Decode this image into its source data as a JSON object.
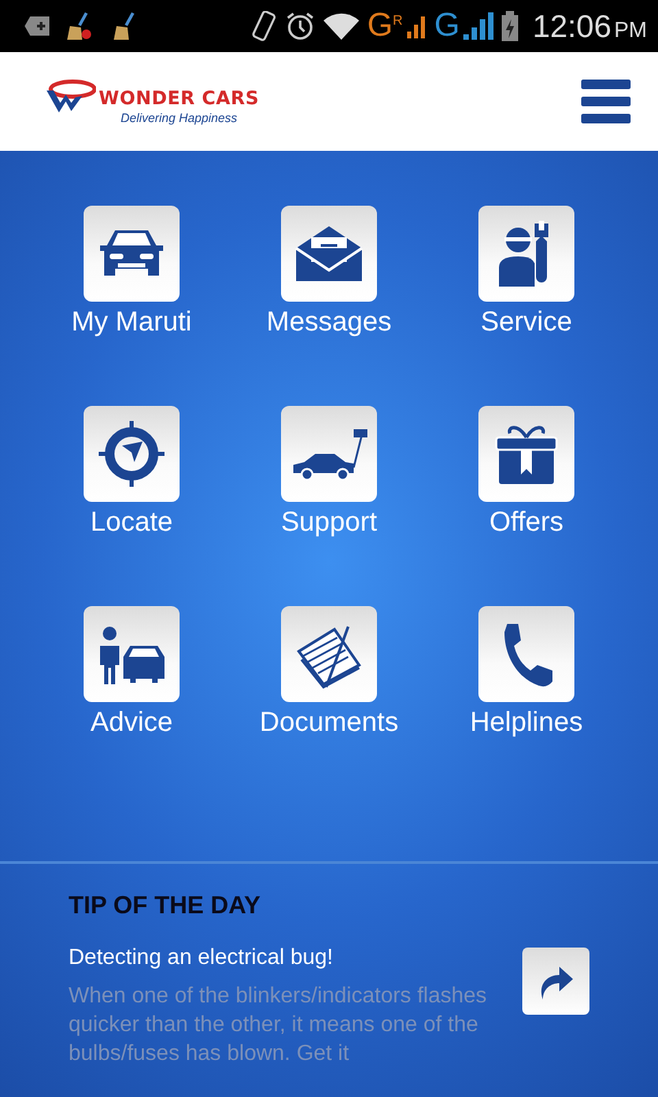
{
  "status_bar": {
    "network_1": "G",
    "roaming": "R",
    "network_2": "G",
    "time": "12:06",
    "meridiem": "PM"
  },
  "header": {
    "brand": "WONDER CARS",
    "tagline": "Delivering Happiness"
  },
  "menu": [
    {
      "label": "My Maruti",
      "kind": "car"
    },
    {
      "label": "Messages",
      "kind": "envelope"
    },
    {
      "label": "Service",
      "kind": "mechanic"
    },
    {
      "label": "Locate",
      "kind": "target"
    },
    {
      "label": "Support",
      "kind": "tow"
    },
    {
      "label": "Offers",
      "kind": "gift"
    },
    {
      "label": "Advice",
      "kind": "advisor"
    },
    {
      "label": "Documents",
      "kind": "papers"
    },
    {
      "label": "Helplines",
      "kind": "phone"
    }
  ],
  "tip": {
    "title": "TIP OF THE DAY",
    "heading": "Detecting an electrical bug!",
    "body": "When one of the blinkers/indicators flashes quicker than the other, it means one of the bulbs/fuses has blown. Get it"
  }
}
